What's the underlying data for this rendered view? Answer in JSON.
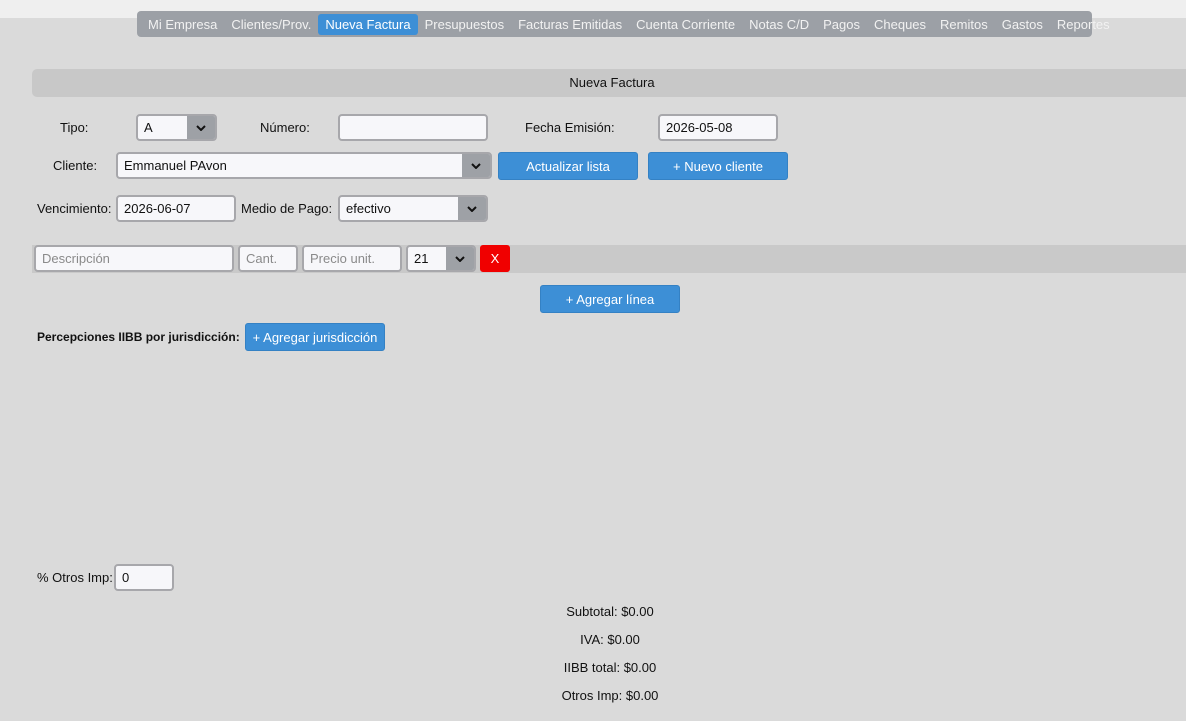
{
  "nav": {
    "items": [
      {
        "label": "Mi Empresa"
      },
      {
        "label": "Clientes/Prov."
      },
      {
        "label": "Nueva Factura"
      },
      {
        "label": "Presupuestos"
      },
      {
        "label": "Facturas Emitidas"
      },
      {
        "label": "Cuenta Corriente"
      },
      {
        "label": "Notas C/D"
      },
      {
        "label": "Pagos"
      },
      {
        "label": "Cheques"
      },
      {
        "label": "Remitos"
      },
      {
        "label": "Gastos"
      },
      {
        "label": "Reportes"
      }
    ],
    "active_index": 2
  },
  "section": {
    "title": "Nueva Factura"
  },
  "form": {
    "tipo_label": "Tipo:",
    "tipo_value": "A",
    "numero_label": "Número:",
    "numero_value": "",
    "fecha_label": "Fecha Emisión:",
    "fecha_value": "2026-05-08",
    "cliente_label": "Cliente:",
    "cliente_value": "Emmanuel PAvon",
    "actualizar_label": "Actualizar lista",
    "nuevo_cliente_label": "+ Nuevo cliente",
    "vencimiento_label": "Vencimiento:",
    "vencimiento_value": "2026-06-07",
    "medio_label": "Medio de Pago:",
    "medio_value": "efectivo"
  },
  "line": {
    "descripcion_placeholder": "Descripción",
    "cant_placeholder": "Cant.",
    "precio_placeholder": "Precio unit.",
    "iva_value": "21",
    "remove_label": "X",
    "add_label": "+ Agregar línea"
  },
  "iibb": {
    "label": "Percepciones IIBB por jurisdicción:",
    "add_label": "+ Agregar jurisdicción"
  },
  "otros": {
    "label": "% Otros Imp:",
    "value": "0"
  },
  "totals": {
    "subtotal": "Subtotal: $0.00",
    "iva": "IVA: $0.00",
    "iibb": "IIBB total: $0.00",
    "otros": "Otros Imp: $0.00"
  },
  "colors": {
    "accent": "#3d8fd6",
    "danger": "#f00000",
    "nav_bg": "#9ca0a6",
    "page_bg": "#dadada"
  }
}
